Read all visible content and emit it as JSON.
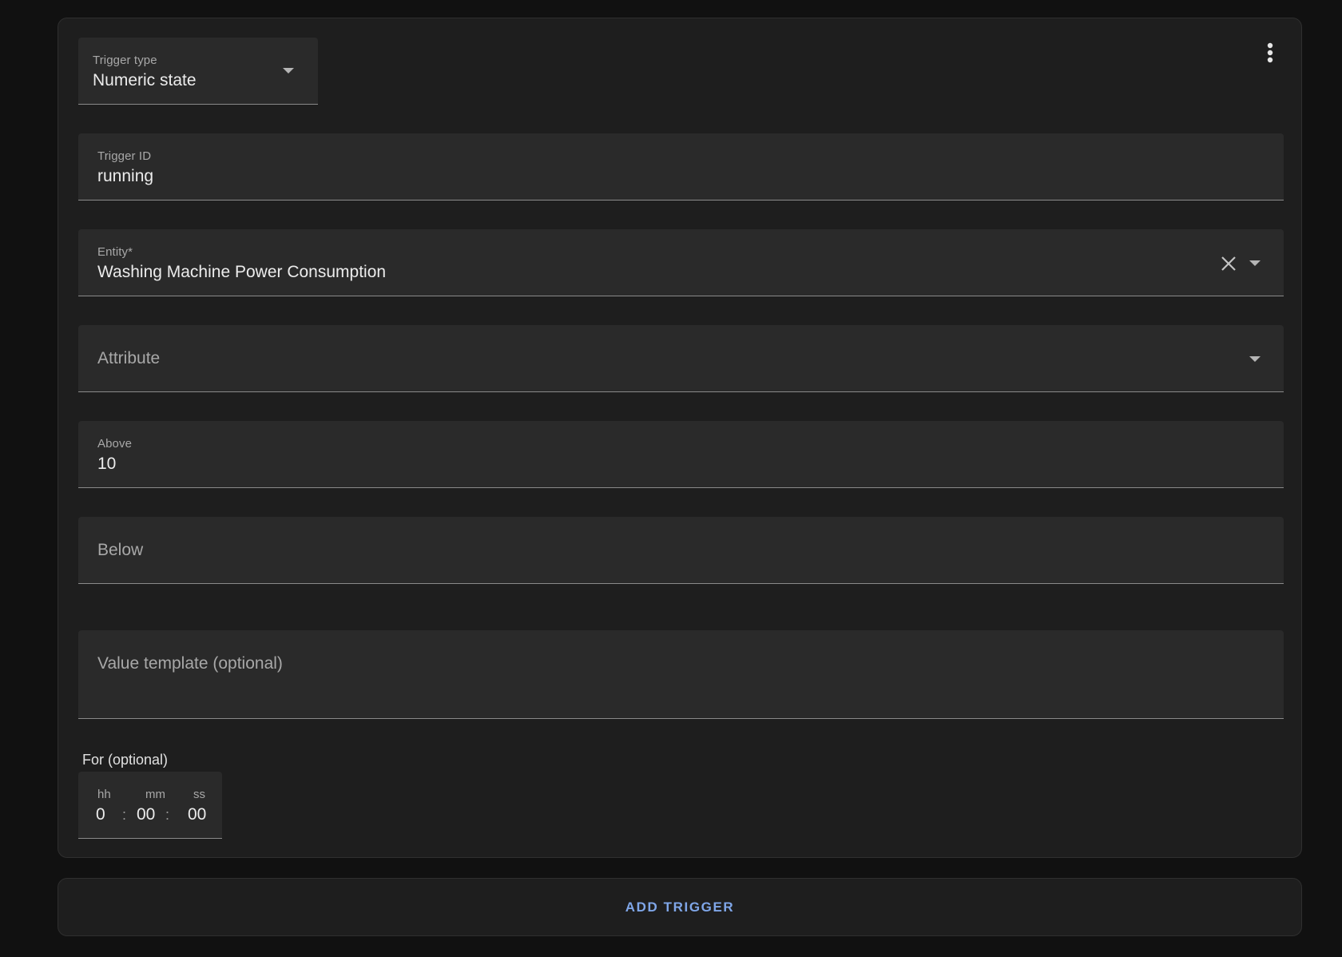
{
  "trigger_type": {
    "label": "Trigger type",
    "value": "Numeric state",
    "icon": "chevron-down-icon"
  },
  "menu": {
    "icon": "more-vertical-icon"
  },
  "trigger_id": {
    "label": "Trigger ID",
    "value": "running"
  },
  "entity": {
    "label": "Entity*",
    "value": "Washing Machine Power Consumption",
    "clear_icon": "close-icon",
    "dropdown_icon": "chevron-down-icon"
  },
  "attribute": {
    "placeholder": "Attribute",
    "dropdown_icon": "chevron-down-icon"
  },
  "above": {
    "label": "Above",
    "value": "10"
  },
  "below": {
    "placeholder": "Below"
  },
  "value_template": {
    "placeholder": "Value template (optional)"
  },
  "for": {
    "label": "For (optional)",
    "hours_label": "hh",
    "minutes_label": "mm",
    "seconds_label": "ss",
    "hours": "0",
    "minutes": "00",
    "seconds": "00",
    "separator": ":"
  },
  "add_trigger": {
    "label": "ADD TRIGGER"
  },
  "colors": {
    "background": "#111111",
    "card": "#1e1e1e",
    "field": "#2a2a2a",
    "accent": "#7fa6e8"
  }
}
